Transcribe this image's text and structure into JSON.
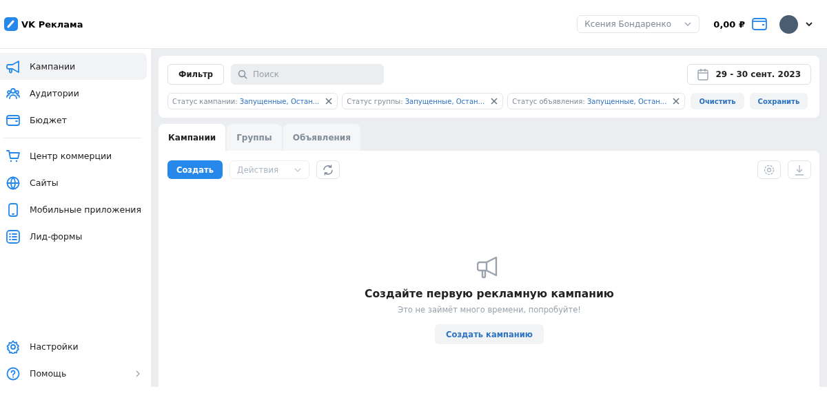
{
  "header": {
    "logo": "VK Реклама",
    "account": "Ксения Бондаренко",
    "balance": "0,00 ₽"
  },
  "sidebar": {
    "items": [
      {
        "label": "Кампании",
        "selected": true
      },
      {
        "label": "Аудитории",
        "selected": false
      },
      {
        "label": "Бюджет",
        "selected": false
      },
      {
        "label": "Центр коммерции",
        "selected": false
      },
      {
        "label": "Сайты",
        "selected": false
      },
      {
        "label": "Мобильные приложения",
        "selected": false
      },
      {
        "label": "Лид-формы",
        "selected": false
      }
    ],
    "bottom_items": [
      {
        "label": "Настройки",
        "has_submenu": false
      },
      {
        "label": "Помощь",
        "has_submenu": true
      }
    ]
  },
  "filters": {
    "button": "Фильтр",
    "search": {
      "placeholder": "Поиск"
    },
    "date_range": "29 - 30 сент. 2023",
    "chips": [
      {
        "label": "Статус кампании:",
        "value": "Запущенные, Остан..."
      },
      {
        "label": "Статус группы:",
        "value": "Запущенные, Остан..."
      },
      {
        "label": "Статус объявления:",
        "value": "Запущенные, Остан..."
      }
    ],
    "clear": "Очистить",
    "save": "Сохранить"
  },
  "tabs": [
    {
      "label": "Кампании",
      "selected": true
    },
    {
      "label": "Группы",
      "selected": false
    },
    {
      "label": "Объявления",
      "selected": false
    }
  ],
  "toolbar": {
    "create": "Создать",
    "actions": {
      "placeholder": "Действия",
      "disabled": true
    }
  },
  "empty_state": {
    "title": "Создайте первую рекламную кампанию",
    "subtitle": "Это не займёт много времени, попробуйте!",
    "button": "Создать кампанию"
  }
}
